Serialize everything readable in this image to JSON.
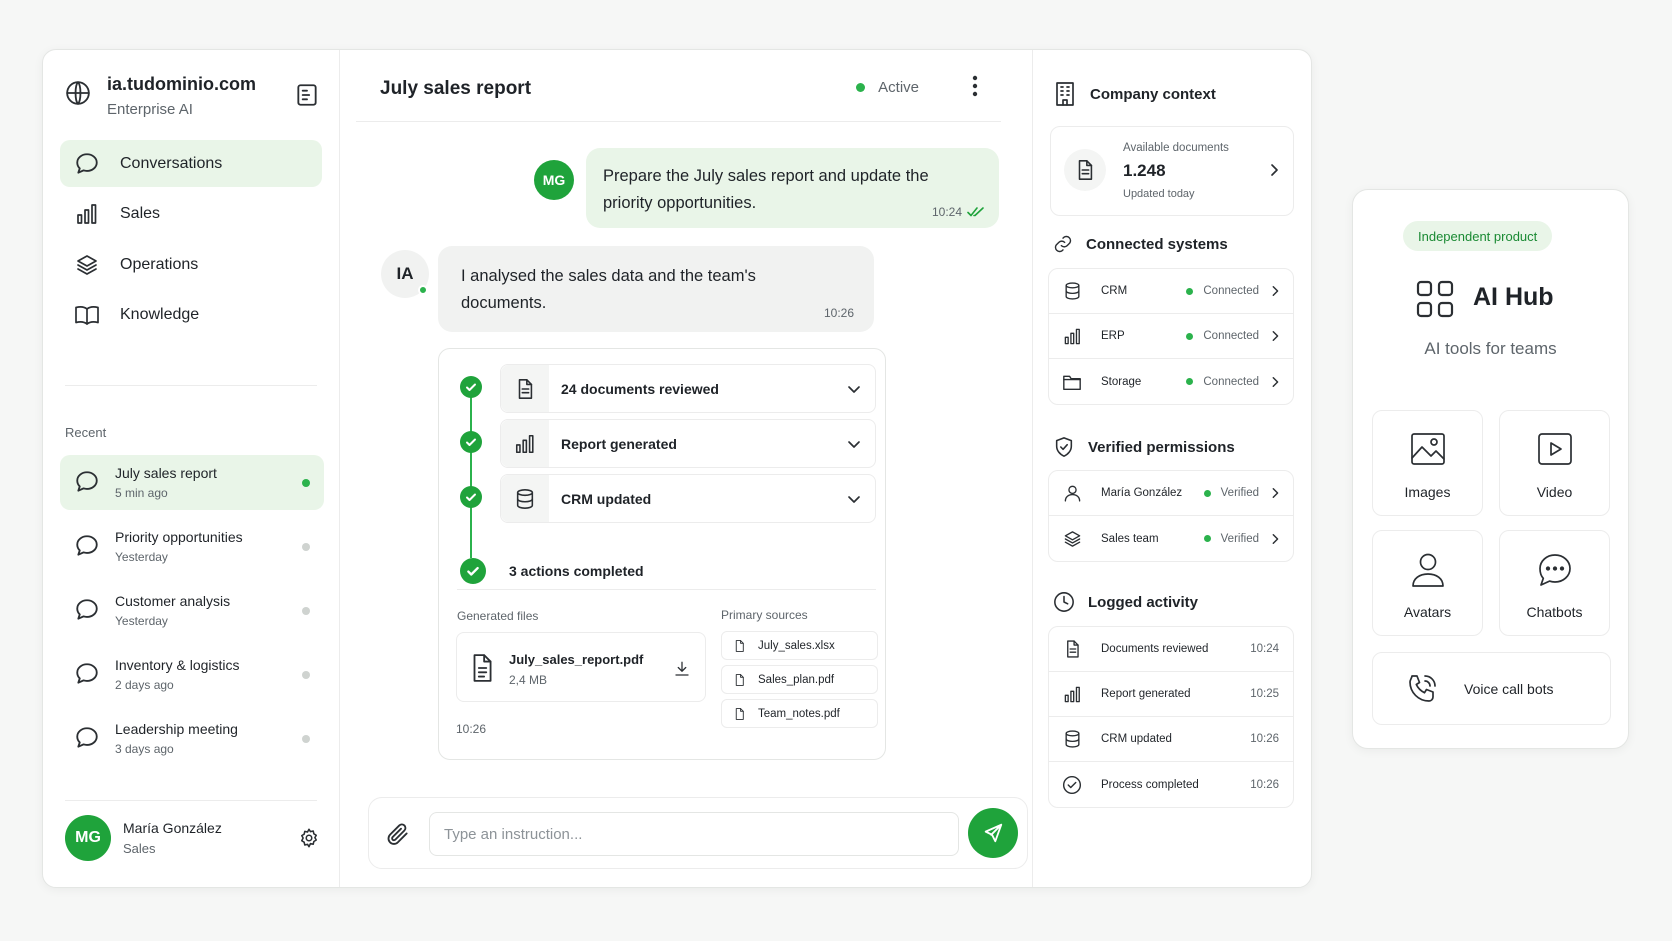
{
  "brand": {
    "domain": "ia.tudominio.com",
    "subtitle": "Enterprise AI"
  },
  "nav": [
    {
      "label": "Conversations",
      "icon": "chat-bubble-icon",
      "active": true
    },
    {
      "label": "Sales",
      "icon": "bar-chart-icon"
    },
    {
      "label": "Operations",
      "icon": "layers-icon"
    },
    {
      "label": "Knowledge",
      "icon": "book-icon"
    }
  ],
  "recent": {
    "title": "Recent",
    "items": [
      {
        "title": "July sales report",
        "time": "5 min ago",
        "active": true
      },
      {
        "title": "Priority opportunities",
        "time": "Yesterday"
      },
      {
        "title": "Customer analysis",
        "time": "Yesterday"
      },
      {
        "title": "Inventory & logistics",
        "time": "2 days ago"
      },
      {
        "title": "Leadership meeting",
        "time": "3 days ago"
      }
    ]
  },
  "user": {
    "initials": "MG",
    "name": "María González",
    "role": "Sales"
  },
  "chat": {
    "title": "July sales report",
    "status": "Active",
    "user_message": {
      "initials": "MG",
      "text": "Prepare the July sales report and update the priority opportunities.",
      "time": "10:24"
    },
    "ai_message": {
      "initials": "IA",
      "text": "I analysed the sales data and the team's documents.",
      "time": "10:26"
    },
    "steps": [
      {
        "label": "24 documents reviewed",
        "icon": "document-icon"
      },
      {
        "label": "Report generated",
        "icon": "bar-chart-icon"
      },
      {
        "label": "CRM updated",
        "icon": "database-icon"
      }
    ],
    "completed": "3 actions completed",
    "generated_files_label": "Generated files",
    "file": {
      "name": "July_sales_report.pdf",
      "size": "2,4 MB"
    },
    "primary_sources_label": "Primary sources",
    "sources": [
      "July_sales.xlsx",
      "Sales_plan.pdf",
      "Team_notes.pdf"
    ],
    "card_time": "10:26",
    "composer_placeholder": "Type an instruction..."
  },
  "context": {
    "title": "Company context",
    "docs": {
      "label": "Available documents",
      "value": "1.248",
      "updated": "Updated today"
    },
    "systems_title": "Connected systems",
    "systems": [
      {
        "name": "CRM",
        "status": "Connected",
        "icon": "database-icon"
      },
      {
        "name": "ERP",
        "status": "Connected",
        "icon": "bar-chart-icon"
      },
      {
        "name": "Storage",
        "status": "Connected",
        "icon": "folder-icon"
      }
    ],
    "permissions_title": "Verified permissions",
    "permissions": [
      {
        "name": "María González",
        "status": "Verified",
        "icon": "person-icon"
      },
      {
        "name": "Sales team",
        "status": "Verified",
        "icon": "layers-icon"
      }
    ],
    "activity_title": "Logged activity",
    "activity": [
      {
        "name": "Documents reviewed",
        "time": "10:24",
        "icon": "document-icon"
      },
      {
        "name": "Report generated",
        "time": "10:25",
        "icon": "bar-chart-icon"
      },
      {
        "name": "CRM updated",
        "time": "10:26",
        "icon": "database-icon"
      },
      {
        "name": "Process completed",
        "time": "10:26",
        "icon": "check-circle-icon"
      }
    ]
  },
  "hub": {
    "badge": "Independent product",
    "title": "AI Hub",
    "subtitle": "AI tools for teams",
    "tools": [
      "Images",
      "Video",
      "Avatars",
      "Chatbots",
      "Voice call bots"
    ]
  },
  "colors": {
    "accent": "#1fa33b",
    "accent_soft": "#e9f5e8",
    "status_dot": "#2bb24c"
  }
}
